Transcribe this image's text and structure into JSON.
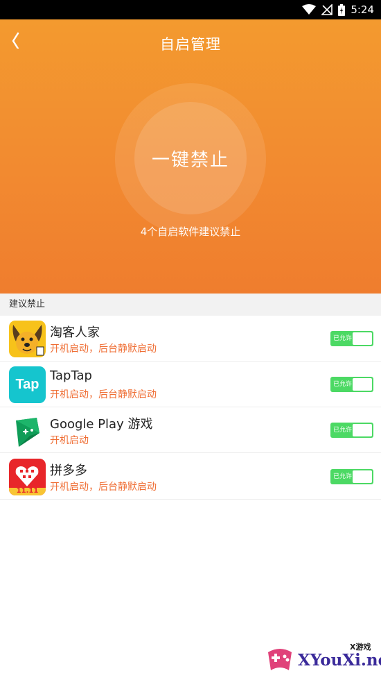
{
  "status_bar": {
    "time": "5:24",
    "icons": [
      "wifi-icon",
      "no-signal-icon",
      "battery-icon"
    ]
  },
  "header": {
    "title": "自启管理",
    "back_icon": "chevron-left-icon",
    "main_button": "一键禁止",
    "hint": "4个自启软件建议禁止"
  },
  "section": {
    "title": "建议禁止"
  },
  "apps": [
    {
      "name": "淘客人家",
      "desc": "开机启动，后台静默启动",
      "toggle_label": "已允许",
      "icon": "taokerenjia-dog-icon"
    },
    {
      "name": "TapTap",
      "desc": "开机启动，后台静默启动",
      "toggle_label": "已允许",
      "icon": "taptap-icon",
      "icon_text": "Tap"
    },
    {
      "name": "Google Play 游戏",
      "desc": "开机启动",
      "toggle_label": "已允许",
      "icon": "google-play-games-icon"
    },
    {
      "name": "拼多多",
      "desc": "开机启动，后台静默启动",
      "toggle_label": "已允许",
      "icon": "pinduoduo-icon",
      "icon_text": "11.11"
    }
  ],
  "watermark": {
    "text": "XYouXi.net",
    "small": "X游戏"
  },
  "colors": {
    "header_top": "#f39a2f",
    "header_bottom": "#ef7d2e",
    "desc": "#ef6d33",
    "toggle_on": "#4cd964"
  }
}
